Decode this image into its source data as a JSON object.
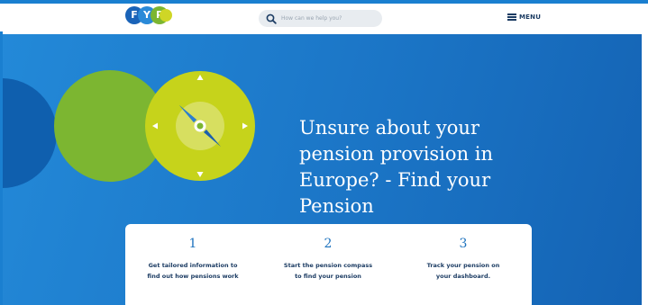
{
  "header": {
    "logo_letters": [
      "F",
      "Y",
      "P"
    ],
    "logo_colors": [
      "#1a63b8",
      "#2a8ad8",
      "#7cb631",
      "#cfd626"
    ],
    "search_placeholder": "How can we help you?",
    "search_icon": "search-icon",
    "menu_icon": "hamburger-icon",
    "menu_label": "MENU"
  },
  "hero": {
    "headline_lines": [
      "Unsure about your",
      "pension provision in",
      "Europe? - Find your",
      "Pension"
    ],
    "compass_icon": "compass-icon",
    "colors": {
      "background": "#1b75c6",
      "circle_dark": "#0f5fae",
      "circle_green": "#7cb631",
      "circle_lime": "#c6d31b"
    }
  },
  "steps": [
    {
      "number": "1",
      "lines": [
        "Get tailored information to",
        "find out how pensions work"
      ]
    },
    {
      "number": "2",
      "lines": [
        "Start the pension compass",
        "to find your pension"
      ]
    },
    {
      "number": "3",
      "lines": [
        "Track your pension on",
        "your dashboard."
      ]
    }
  ]
}
